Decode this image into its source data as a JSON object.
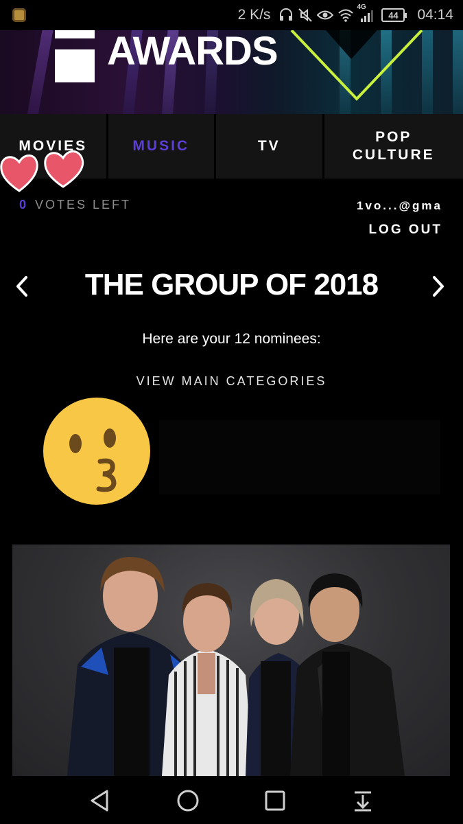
{
  "status_bar": {
    "net_speed": "2 K/s",
    "network_type": "4G",
    "battery": "44",
    "time": "04:14",
    "icons": [
      "app-icon",
      "headphones-icon",
      "mute-icon",
      "eye-icon",
      "wifi-icon",
      "signal-icon",
      "battery-icon"
    ]
  },
  "banner": {
    "title": "AWARDS",
    "accent_color": "#c8f03c"
  },
  "tabs": [
    {
      "label": "MOVIES",
      "active": false
    },
    {
      "label": "MUSIC",
      "active": true
    },
    {
      "label": "TV",
      "active": false
    },
    {
      "label": "POP CULTURE",
      "active": false
    }
  ],
  "votes": {
    "count": "0",
    "label": "VOTES LEFT"
  },
  "account": {
    "email": "1vo...@gma",
    "logout_label": "LOG OUT"
  },
  "category": {
    "title": "THE GROUP OF 2018",
    "nominees_text": "Here are your 12 nominees:",
    "view_main_label": "VIEW MAIN CATEGORIES"
  },
  "colors": {
    "active_tab": "#5b3fd6",
    "tab_bg": "#141414",
    "page_bg": "#000000"
  },
  "stickers": [
    "hearts-sticker",
    "kissing-face-emoji"
  ],
  "android_nav": [
    "back-icon",
    "home-icon",
    "recents-icon",
    "notification-pull-icon"
  ]
}
